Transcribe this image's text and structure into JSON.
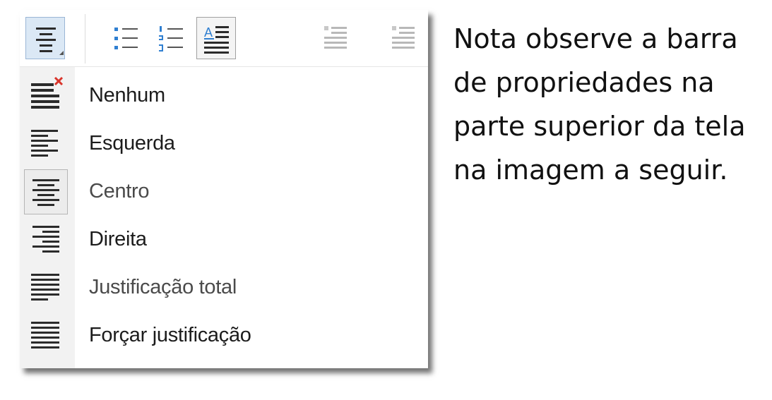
{
  "toolbar": {
    "buttons": [
      {
        "icon": "align-center-dropdown-icon",
        "state": "active"
      },
      {
        "icon": "bulleted-list-icon",
        "state": "normal"
      },
      {
        "icon": "numbered-list-icon",
        "state": "normal"
      },
      {
        "icon": "paragraph-style-icon",
        "state": "pressed"
      },
      {
        "icon": "increase-indent-icon",
        "state": "disabled"
      },
      {
        "icon": "decrease-indent-icon",
        "state": "disabled"
      }
    ]
  },
  "menu": {
    "items": [
      {
        "label": "Nenhum",
        "icon": "align-none-icon",
        "checked": false
      },
      {
        "label": "Esquerda",
        "icon": "align-left-icon",
        "checked": false
      },
      {
        "label": "Centro",
        "icon": "align-center-icon",
        "checked": true
      },
      {
        "label": "Direita",
        "icon": "align-right-icon",
        "checked": false
      },
      {
        "label": "Justificação total",
        "icon": "justify-icon",
        "checked": false
      },
      {
        "label": "Forçar justificação",
        "icon": "force-justify-icon",
        "checked": false
      }
    ]
  },
  "caption": {
    "line1": "Nota observe a barra",
    "line2": "de propriedades na",
    "line3": "parte superior da tela",
    "line4": "na imagem a seguir."
  },
  "colors": {
    "active_button_bg": "#dbe8f5",
    "icon_blue": "#2f7fd1",
    "close_red": "#d9342b",
    "icon_dark": "#2b2b2b",
    "disabled_gray": "#b8b8b8"
  }
}
